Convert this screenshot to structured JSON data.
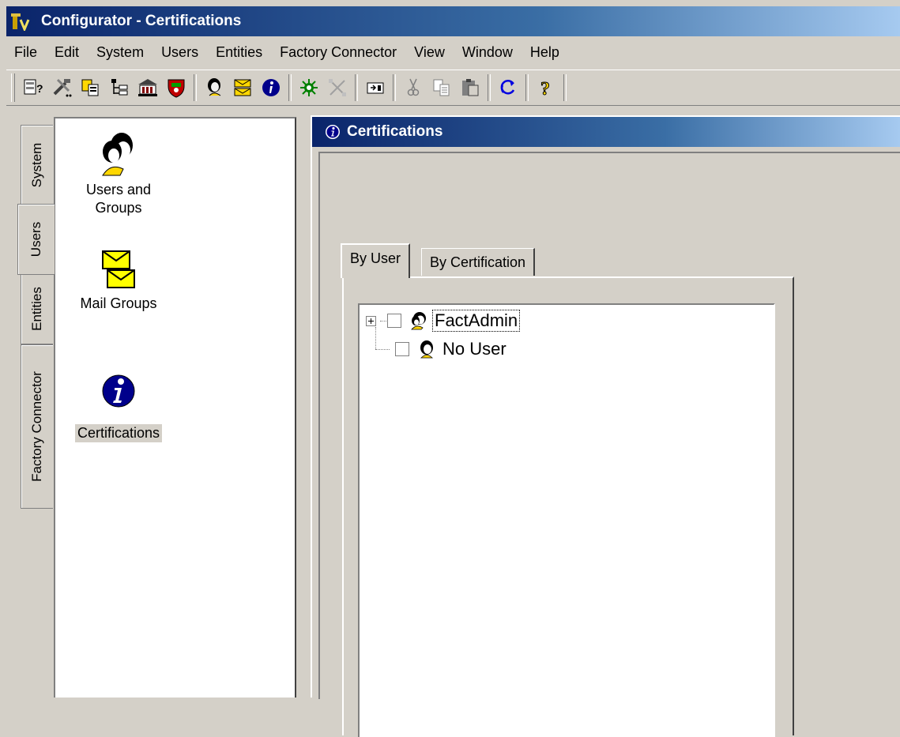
{
  "window": {
    "title": "Configurator - Certifications"
  },
  "menu": {
    "items": [
      "File",
      "Edit",
      "System",
      "Users",
      "Entities",
      "Factory Connector",
      "View",
      "Window",
      "Help"
    ]
  },
  "toolbar": {
    "icons": [
      "system-help-icon",
      "tools-icon",
      "copy-objects-icon",
      "tree-icon",
      "building-icon",
      "shield-icon",
      "user-icon",
      "mail-icon",
      "info-icon",
      "connector-icon",
      "disconnect-icon",
      "window-icon",
      "cut-icon",
      "copy-icon",
      "paste-icon",
      "refresh-icon",
      "help-icon"
    ]
  },
  "sidebar_tabs": [
    "System",
    "Users",
    "Entities",
    "Factory Connector"
  ],
  "shortcuts": [
    {
      "label_line1": "Users and",
      "label_line2": "Groups",
      "icon": "users-groups-icon"
    },
    {
      "label": "Mail Groups",
      "icon": "mail-groups-icon"
    },
    {
      "label": "Certifications",
      "icon": "certifications-icon"
    }
  ],
  "mdi": {
    "title": "Certifications",
    "tabs": [
      "By User",
      "By Certification"
    ]
  },
  "tree": {
    "nodes": [
      {
        "label": "FactAdmin"
      },
      {
        "label": "No User"
      }
    ]
  }
}
